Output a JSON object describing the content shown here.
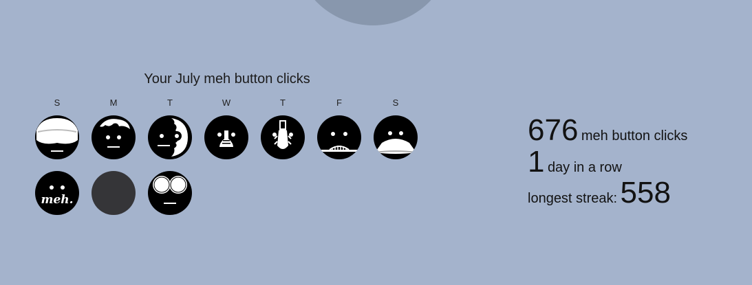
{
  "calendar": {
    "title": "Your July meh button clicks",
    "weekdays": [
      "S",
      "M",
      "T",
      "W",
      "T",
      "F",
      "S"
    ],
    "days": [
      {
        "icon": "goggles-face-icon",
        "state": "clicked"
      },
      {
        "icon": "hair-face-icon",
        "state": "clicked"
      },
      {
        "icon": "half-face-icon",
        "state": "clicked"
      },
      {
        "icon": "bottle-face-icon",
        "state": "clicked"
      },
      {
        "icon": "bug-face-icon",
        "state": "clicked"
      },
      {
        "icon": "grill-face-icon",
        "state": "clicked"
      },
      {
        "icon": "mustache-face-icon",
        "state": "clicked"
      },
      {
        "icon": "meh-text-face-icon",
        "state": "clicked",
        "text": "meh."
      },
      {
        "icon": "empty-day-icon",
        "state": "missed"
      },
      {
        "icon": "big-eyes-face-icon",
        "state": "clicked"
      }
    ]
  },
  "stats": {
    "total_clicks": "676",
    "total_clicks_label": "meh button clicks",
    "streak": "1",
    "streak_label": "day in a row",
    "longest_label": "longest streak:",
    "longest": "558"
  },
  "colors": {
    "background": "#a4b3cc",
    "top_circle": "#8897ad",
    "face": "#000000",
    "missed_day": "#353538"
  }
}
